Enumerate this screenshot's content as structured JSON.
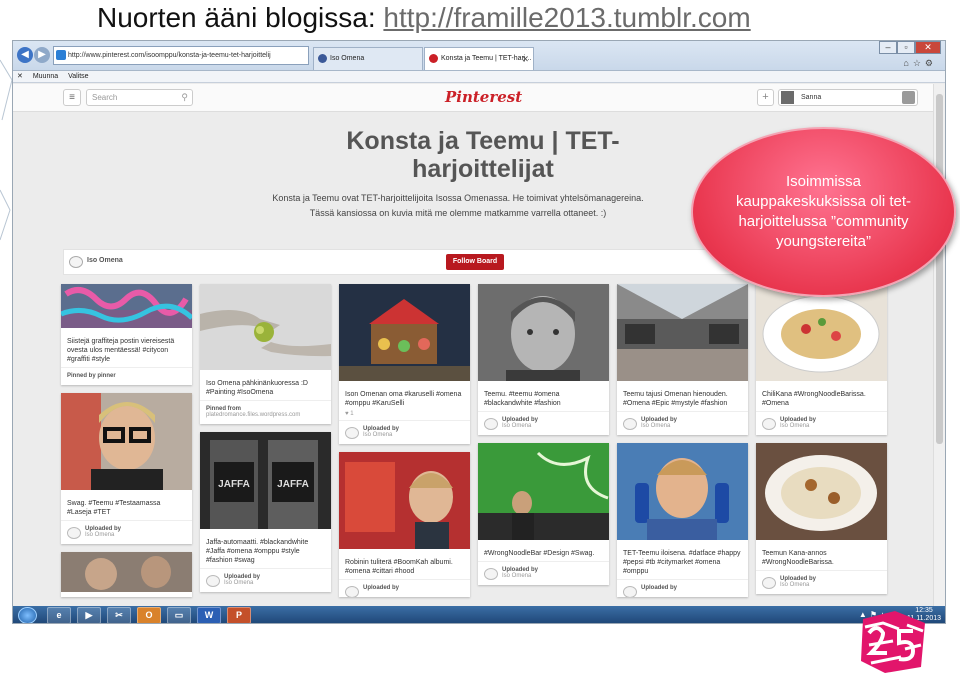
{
  "slide": {
    "title_prefix": "Nuorten ääni blogissa: ",
    "title_url": "http://framille2013.tumblr.com"
  },
  "browser": {
    "address": "http://www.pinterest.com/isoomppu/konsta-ja-teemu-tet-harjoittelij",
    "tabs": [
      {
        "label": "Iso Omena"
      },
      {
        "label": "Konsta ja Teemu | TET-harj..."
      }
    ],
    "menu": [
      "Muunna",
      "Valitse"
    ]
  },
  "pinterest": {
    "search_placeholder": "Search",
    "logo": "Pinterest",
    "user_name": "Sanna",
    "board_title": "Konsta ja Teemu | TET-harjoittelijat",
    "board_description": "Konsta ja Teemu ovat TET-harjoittelijoita Isossa Omenassa. He toimivat yhtelsömanagereina. Tässä kansiossa on kuvia mitä me olemme matkamme varrella ottaneet. :)",
    "owner": "Iso Omena",
    "follow_label": "Follow Board"
  },
  "pins": {
    "c1": [
      {
        "desc": "Siistejä graffiteja postin viereisestä ovesta ulos mentäessä! #citycon #graffiti #style",
        "foot1": "Pinned by pinner",
        "foot2": ""
      },
      {
        "desc": "Swag. #Teemu #Testaamassa #Laseja #TET",
        "foot1": "Uploaded by",
        "foot2": "Iso Omena"
      },
      {
        "desc": "",
        "foot1": "",
        "foot2": ""
      }
    ],
    "c2": [
      {
        "desc": "Iso Omena pähkinänkuoressa :D #Painting #IsoOmena",
        "foot1": "Pinned from",
        "foot2": "platedromance.files.wordpress.com"
      },
      {
        "desc": "Jaffa-automaatti. #blackandwhite #Jaffa #omena #omppu #style #fashion #swag",
        "foot1": "Uploaded by",
        "foot2": "Iso Omena"
      }
    ],
    "c3": [
      {
        "desc": "Ison Omenan oma #karuselli #omena #omppu #KaruSelli",
        "stat": "♥ 1",
        "foot1": "Uploaded by",
        "foot2": "Iso Omena"
      },
      {
        "desc": "Robinin tuliterä #BoomKah albumi. #omena #cittari #hood",
        "foot1": "Uploaded by",
        "foot2": ""
      }
    ],
    "c4": [
      {
        "desc": "Teemu. #teemu #omena #blackandwhite #fashion",
        "foot1": "Uploaded by",
        "foot2": "Iso Omena"
      },
      {
        "desc": "#WrongNoodleBar #Design #Swag.",
        "foot1": "Uploaded by",
        "foot2": "Iso Omena"
      }
    ],
    "c5": [
      {
        "desc": "Teemu tajusi Omenan hienouden. #Omena #Epic #mystyle #fashion",
        "foot1": "Uploaded by",
        "foot2": "Iso Omena"
      },
      {
        "desc": "TET-Teemu iloisena. #datface #happy #pepsi #tb #citymarket #omena #omppu",
        "foot1": "Uploaded by",
        "foot2": ""
      }
    ],
    "c6": [
      {
        "desc": "ChiliKana #WrongNoodleBarissa. #Omena",
        "foot1": "Uploaded by",
        "foot2": "Iso Omena"
      },
      {
        "desc": "Teemun Kana-annos #WrongNoodleBarissa.",
        "foot1": "Uploaded by",
        "foot2": "Iso Omena"
      }
    ]
  },
  "taskbar": {
    "apps": [
      "e",
      "▶",
      "✂",
      "O",
      "▭",
      "W",
      "P"
    ],
    "time": "12:35",
    "date": "11.11.2013"
  },
  "callout": {
    "text": "Isoimmissa kauppakeskuksissa oli tet-harjoittelussa ”community youngstereita”"
  },
  "colors": {
    "pinterest_red": "#cb2027",
    "callout_pink": "#e9374f"
  }
}
